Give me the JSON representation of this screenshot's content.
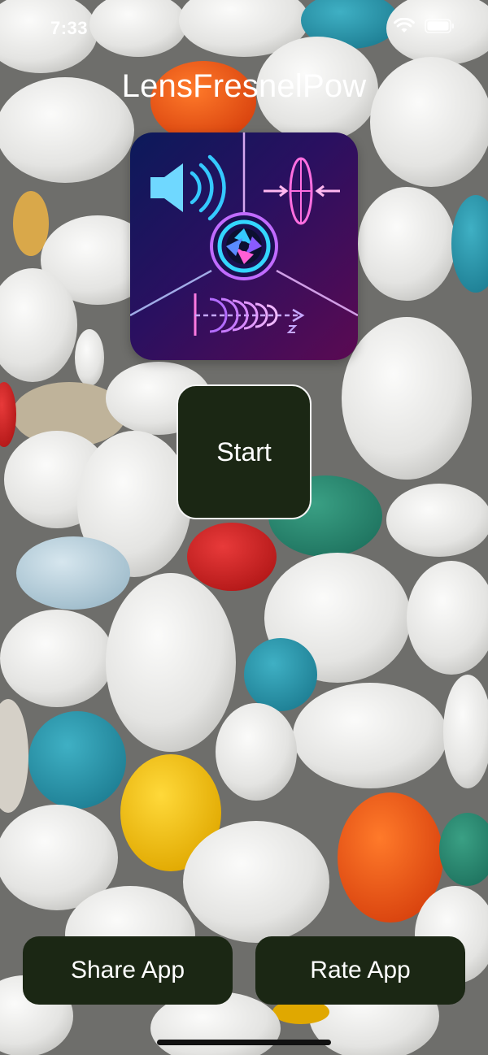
{
  "status_bar": {
    "time": "7:33",
    "wifi_icon": "wifi-icon",
    "battery_icon": "battery-icon"
  },
  "app": {
    "title": "LensFresnelPow"
  },
  "logo": {
    "icon": "app-logo-icon",
    "accent_colors": [
      "#2fd0ff",
      "#ff3fd8",
      "#9b4dff"
    ]
  },
  "buttons": {
    "start": "Start",
    "share": "Share App",
    "rate": "Rate App"
  },
  "colors": {
    "button_bg": "#1b2714",
    "text": "#ffffff"
  }
}
